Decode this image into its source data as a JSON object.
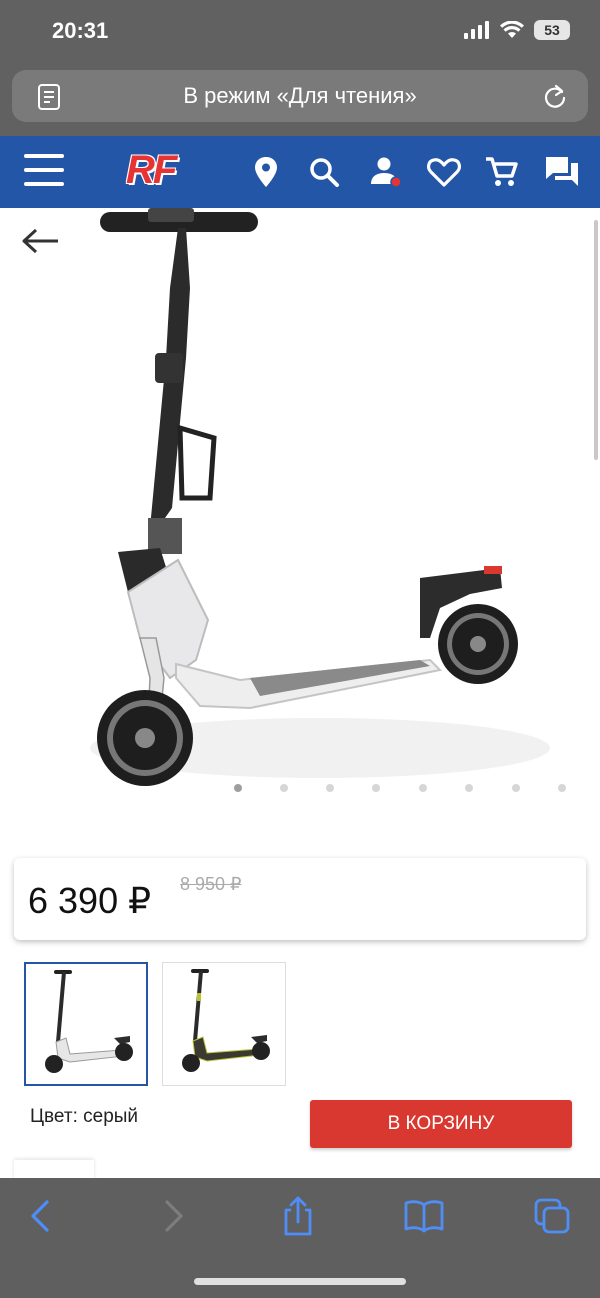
{
  "status_bar": {
    "time": "20:31",
    "battery": "53"
  },
  "browser": {
    "address_text": "В режим «Для чтения»"
  },
  "header": {
    "logo": "RF"
  },
  "product": {
    "price": "6 390 ₽",
    "old_price": "8 950 ₽",
    "color_label": "Цвет: серый",
    "cart_button": "В КОРЗИНУ",
    "gallery_dots": 8,
    "active_dot": 0
  },
  "colors": {
    "header_blue": "#2456a8",
    "cart_red": "#d93830",
    "toolbar_gray": "#5f5f5f",
    "ios_blue": "#4f8ef7"
  }
}
